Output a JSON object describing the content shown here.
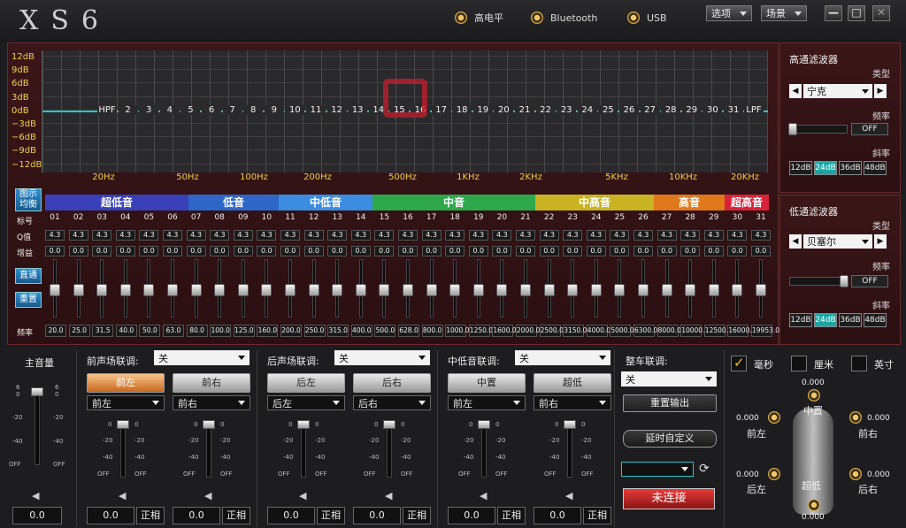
{
  "app": {
    "title": "XS6"
  },
  "inputs": [
    {
      "label": "高电平"
    },
    {
      "label": "Bluetooth"
    },
    {
      "label": "USB"
    }
  ],
  "menu": {
    "options": "选项",
    "scene": "场景"
  },
  "window": {
    "min": "—",
    "max": "□",
    "close": "✕"
  },
  "graph": {
    "db_labels": [
      "12dB",
      "9dB",
      "6dB",
      "3dB",
      "0dB",
      "−3dB",
      "−6dB",
      "−9dB",
      "−12dB"
    ],
    "freq_labels": [
      "20Hz",
      "50Hz",
      "100Hz",
      "200Hz",
      "500Hz",
      "1KHz",
      "2KHz",
      "5KHz",
      "10KHz",
      "20KHz"
    ],
    "point_labels": [
      "HPF",
      "2",
      "3",
      "4",
      "5",
      "6",
      "7",
      "8",
      "9",
      "10",
      "11",
      "12",
      "13",
      "14",
      "15",
      "16",
      "17",
      "18",
      "19",
      "20",
      "21",
      "22",
      "23",
      "24",
      "25",
      "26",
      "27",
      "28",
      "29",
      "30",
      "31",
      "LPF"
    ]
  },
  "eq": {
    "graph_mode_button": "图示均衡",
    "bands": [
      {
        "label": "超低音",
        "color": "#3940b8"
      },
      {
        "label": "低音",
        "color": "#2e66c8"
      },
      {
        "label": "中低音",
        "color": "#3c8de0"
      },
      {
        "label": "中音",
        "color": "#2ea84a"
      },
      {
        "label": "中高音",
        "color": "#c9b322"
      },
      {
        "label": "高音",
        "color": "#e0781c"
      },
      {
        "label": "超高音",
        "color": "#d8243a"
      }
    ],
    "row_labels": {
      "index": "标号",
      "q": "Q值",
      "gain": "增益",
      "freq": "频率"
    },
    "channels": [
      "01",
      "02",
      "03",
      "04",
      "05",
      "06",
      "07",
      "08",
      "09",
      "10",
      "11",
      "12",
      "13",
      "14",
      "15",
      "16",
      "17",
      "18",
      "19",
      "20",
      "21",
      "22",
      "23",
      "24",
      "25",
      "26",
      "27",
      "28",
      "29",
      "30",
      "31"
    ],
    "q_values": [
      "4.3",
      "4.3",
      "4.3",
      "4.3",
      "4.3",
      "4.3",
      "4.3",
      "4.3",
      "4.3",
      "4.3",
      "4.3",
      "4.3",
      "4.3",
      "4.3",
      "4.3",
      "4.3",
      "4.3",
      "4.3",
      "4.3",
      "4.3",
      "4.3",
      "4.3",
      "4.3",
      "4.3",
      "4.3",
      "4.3",
      "4.3",
      "4.3",
      "4.3",
      "4.3",
      "4.3"
    ],
    "gain_values": [
      "0.0",
      "0.0",
      "0.0",
      "0.0",
      "0.0",
      "0.0",
      "0.0",
      "0.0",
      "0.0",
      "0.0",
      "0.0",
      "0.0",
      "0.0",
      "0.0",
      "0.0",
      "0.0",
      "0.0",
      "0.0",
      "0.0",
      "0.0",
      "0.0",
      "0.0",
      "0.0",
      "0.0",
      "0.0",
      "0.0",
      "0.0",
      "0.0",
      "0.0",
      "0.0",
      "0.0"
    ],
    "freq_values": [
      "20.0",
      "25.0",
      "31.5",
      "40.0",
      "50.0",
      "63.0",
      "80.0",
      "100.0",
      "125.0",
      "160.0",
      "200.0",
      "250.0",
      "315.0",
      "400.0",
      "500.0",
      "628.0",
      "800.0",
      "1000.0",
      "1250.0",
      "1600.0",
      "2000.0",
      "2500.0",
      "3150.0",
      "4000.0",
      "5000.0",
      "6300.0",
      "8000.0",
      "10000.0",
      "12500.0",
      "16000.0",
      "19953.0"
    ],
    "bypass_button": "直通",
    "reset_button": "重置"
  },
  "highpass": {
    "title": "高通滤波器",
    "type_label": "类型",
    "type_value": "宁克",
    "freq_label": "频率",
    "freq_value": "OFF",
    "slope_label": "斜率",
    "slopes": [
      "12dB",
      "24dB",
      "36dB",
      "48dB"
    ],
    "active_slope": "24dB"
  },
  "lowpass": {
    "title": "低通滤波器",
    "type_label": "类型",
    "type_value": "贝塞尔",
    "freq_label": "频率",
    "freq_value": "OFF",
    "slope_label": "斜率",
    "slopes": [
      "12dB",
      "24dB",
      "36dB",
      "48dB"
    ],
    "active_slope": "24dB"
  },
  "master": {
    "label": "主音量",
    "scale_top": "6",
    "scale_0": "0",
    "scale_m20": "-20",
    "scale_m40": "-40",
    "scale_off": "OFF",
    "value": "0.0"
  },
  "groups": [
    {
      "link_label": "前声场联调:",
      "link_value": "关",
      "channels": [
        {
          "button": "前左",
          "style": "orange",
          "select": "前左"
        },
        {
          "button": "前右",
          "style": "grey",
          "select": "前右"
        }
      ]
    },
    {
      "link_label": "后声场联调:",
      "link_value": "关",
      "channels": [
        {
          "button": "后左",
          "style": "grey",
          "select": "后左"
        },
        {
          "button": "后右",
          "style": "grey",
          "select": "后右"
        }
      ]
    },
    {
      "link_label": "中低音联调:",
      "link_value": "关",
      "channels": [
        {
          "button": "中置",
          "style": "grey",
          "select": "前左"
        },
        {
          "button": "超低",
          "style": "grey",
          "select": "前右"
        }
      ]
    }
  ],
  "channel_strip": {
    "scale_0": "0",
    "scale_m20": "-20",
    "scale_m40": "-40",
    "scale_off": "OFF",
    "value": "0.0",
    "invert": "正相"
  },
  "car": {
    "link_label": "整车联调:",
    "link_value": "关",
    "reset_output": "重置输出",
    "delay_custom": "延时自定义",
    "preset_select": "",
    "connect": "未连接"
  },
  "units": {
    "ms": "毫秒",
    "cm": "厘米",
    "inch": "英寸"
  },
  "positions": {
    "top": "0.000",
    "center": "中置",
    "front_left_val": "0.000",
    "front_left": "前左",
    "front_right_val": "0.000",
    "front_right": "前右",
    "rear_left_val": "0.000",
    "rear_left": "后左",
    "rear_right_val": "0.000",
    "rear_right": "后右",
    "sub": "超低",
    "bottom": "0.000"
  },
  "colors": {
    "accent": "#1ba6a4",
    "panel": "#3b1618",
    "gold": "#f0d24a"
  }
}
